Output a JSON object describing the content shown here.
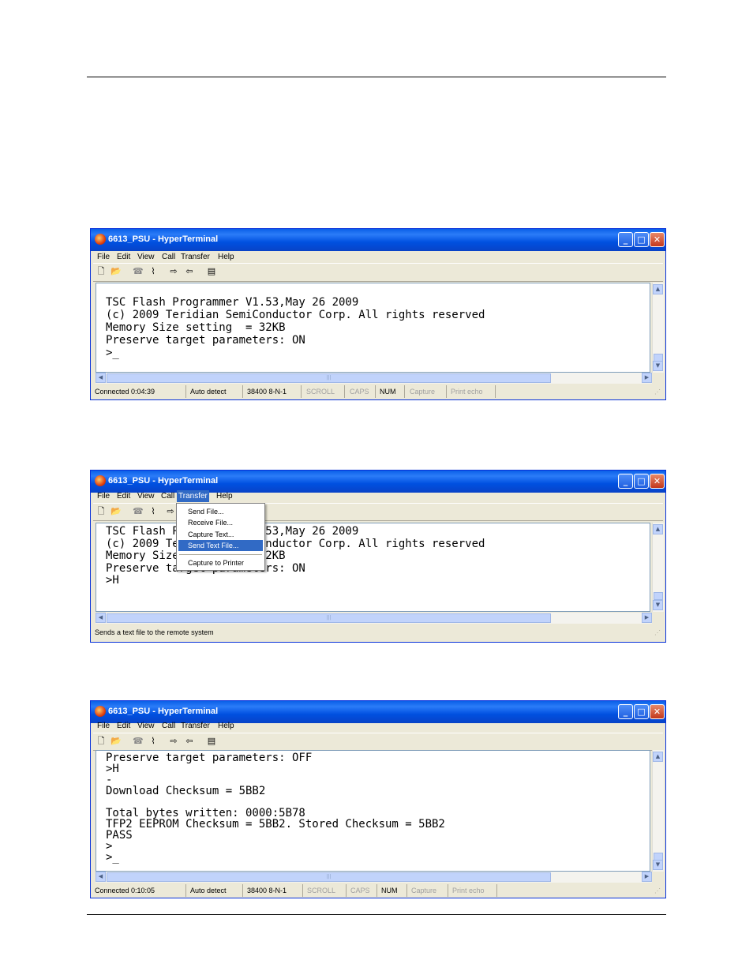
{
  "colors": {
    "titlebar": "#0a5fe8",
    "menu_highlight": "#316ac5",
    "window_bg": "#ece9d8",
    "terminal_bg": "#ffffff"
  },
  "windows": [
    {
      "title": "6613_PSU - HyperTerminal",
      "menu": [
        "File",
        "Edit",
        "View",
        "Call",
        "Transfer",
        "Help"
      ],
      "toolbar_icons": [
        "new-icon",
        "open-icon",
        "phone-icon",
        "disconnect-icon",
        "send-icon",
        "receive-icon",
        "properties-icon"
      ],
      "terminal_lines": [
        "TSC Flash Programmer V1.53,May 26 2009",
        "(c) 2009 Teridian SemiConductor Corp. All rights reserved",
        "Memory Size setting  = 32KB",
        "Preserve target parameters: ON",
        ">_"
      ],
      "status": [
        "Connected 0:04:39",
        "Auto detect",
        "38400 8-N-1",
        "SCROLL",
        "CAPS",
        "NUM",
        "Capture",
        "Print echo"
      ]
    },
    {
      "title": "6613_PSU - HyperTerminal",
      "menu": [
        "File",
        "Edit",
        "View",
        "Call",
        "Transfer",
        "Help"
      ],
      "toolbar_icons": [
        "new-icon",
        "open-icon",
        "phone-icon",
        "disconnect-icon",
        "send-icon"
      ],
      "terminal_lines": [
        "TSC Flash Programmer V1.53,May 26 2009",
        "(c) 2009 Teridian SemiConductor Corp. All rights reserved",
        "Memory Size setting  = 32KB",
        "Preserve target parameters: ON",
        ">H"
      ],
      "dropdown": {
        "items": [
          "Send File...",
          "Receive File...",
          "Capture Text...",
          "Send Text File...",
          "Capture to Printer"
        ],
        "selected": "Send Text File..."
      },
      "status_text": "Sends a text file to the remote system"
    },
    {
      "title": "6613_PSU - HyperTerminal",
      "menu": [
        "File",
        "Edit",
        "View",
        "Call",
        "Transfer",
        "Help"
      ],
      "toolbar_icons": [
        "new-icon",
        "open-icon",
        "phone-icon",
        "disconnect-icon",
        "send-icon",
        "receive-icon",
        "properties-icon"
      ],
      "terminal_lines": [
        "Preserve target parameters: OFF",
        ">H",
        "-",
        "Download Checksum = 5BB2",
        "",
        "Total bytes written: 0000:5B78",
        "TFP2 EEPROM Checksum = 5BB2. Stored Checksum = 5BB2",
        "PASS",
        ">",
        ">_"
      ],
      "status": [
        "Connected 0:10:05",
        "Auto detect",
        "38400 8-N-1",
        "SCROLL",
        "CAPS",
        "NUM",
        "Capture",
        "Print echo"
      ]
    }
  ]
}
